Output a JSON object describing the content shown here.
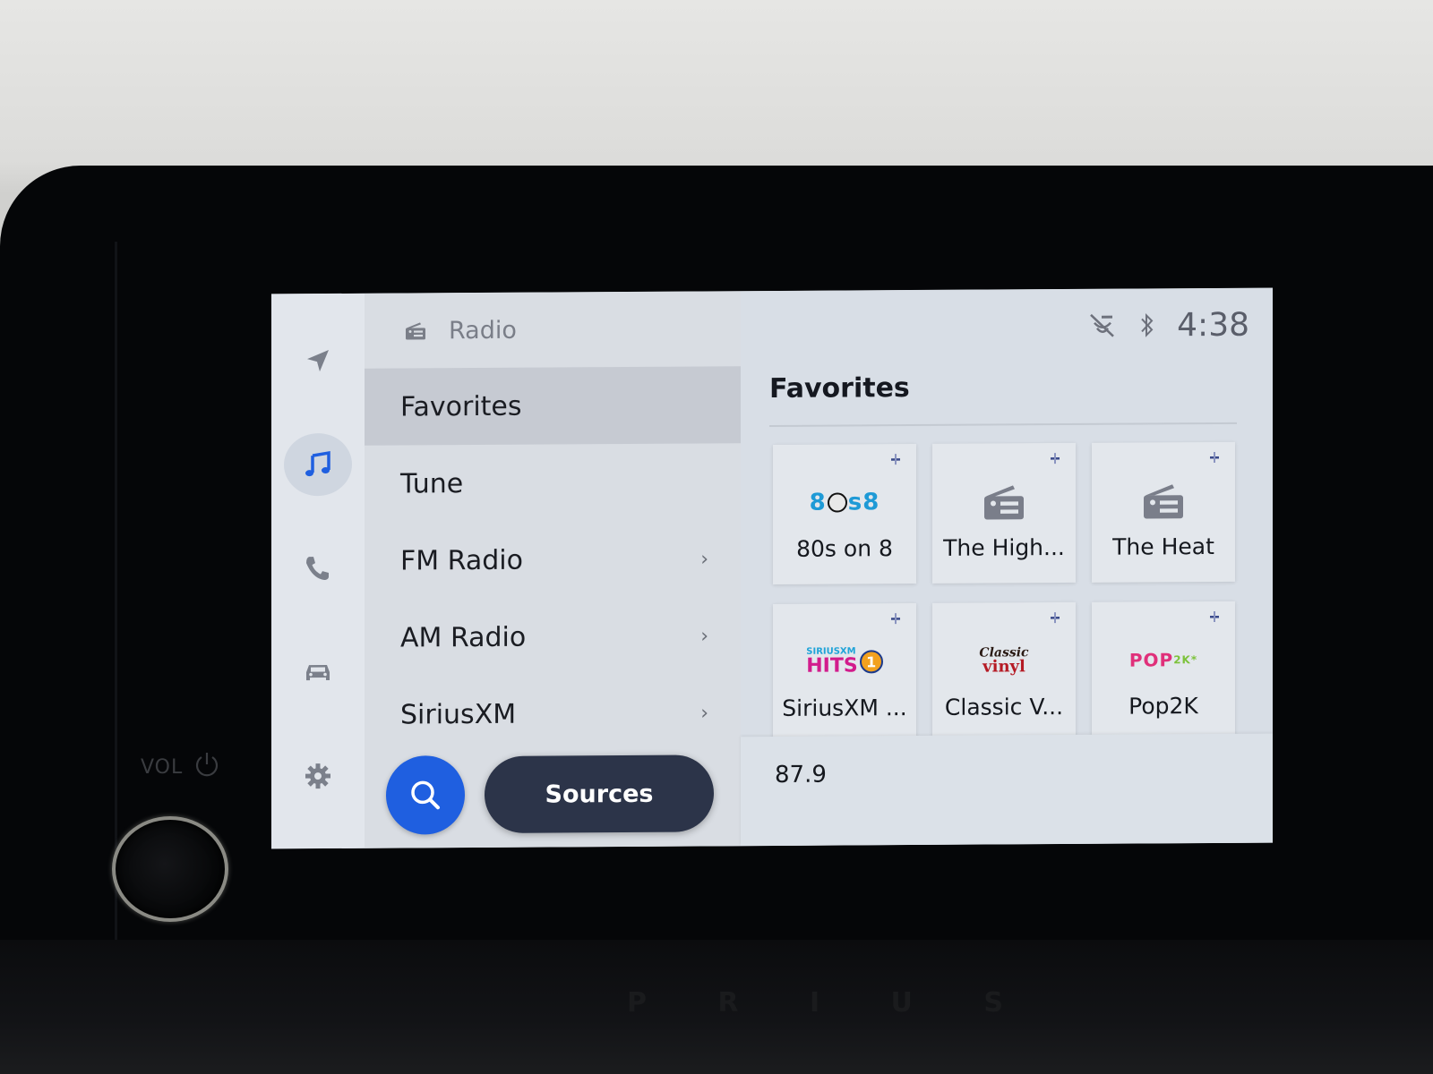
{
  "hardware": {
    "vol_label": "VOL",
    "brand_letters": [
      "P",
      "R",
      "I",
      "U",
      "S"
    ]
  },
  "rail": {
    "items": [
      {
        "name": "navigation",
        "icon": "navigation-arrow-icon",
        "active": false
      },
      {
        "name": "music",
        "icon": "music-note-icon",
        "active": true
      },
      {
        "name": "phone",
        "icon": "phone-icon",
        "active": false
      },
      {
        "name": "vehicle",
        "icon": "car-icon",
        "active": false
      },
      {
        "name": "settings",
        "icon": "gear-icon",
        "active": false
      }
    ],
    "accent_color": "#1f5fe0"
  },
  "menu": {
    "header": {
      "icon": "radio-icon",
      "title": "Radio"
    },
    "items": [
      {
        "label": "Favorites",
        "selected": true,
        "has_chevron": false
      },
      {
        "label": "Tune",
        "selected": false,
        "has_chevron": false
      },
      {
        "label": "FM Radio",
        "selected": false,
        "has_chevron": true
      },
      {
        "label": "AM Radio",
        "selected": false,
        "has_chevron": true
      },
      {
        "label": "SiriusXM",
        "selected": false,
        "has_chevron": true
      }
    ],
    "chevron_glyph": "›",
    "search_button": {
      "icon": "search-icon"
    },
    "sources_button": {
      "label": "Sources"
    }
  },
  "status_bar": {
    "icons": [
      "mic-off-icon",
      "bluetooth-icon"
    ],
    "clock": "4:38"
  },
  "content": {
    "title": "Favorites",
    "favorites": [
      {
        "name": "80s on 8",
        "logo": "80s-on-8-logo",
        "logo_text": "8",
        "logo_text2": "s8"
      },
      {
        "name": "The High...",
        "logo": "radio-icon"
      },
      {
        "name": "The Heat",
        "logo": "radio-icon"
      },
      {
        "name": "SiriusXM ...",
        "logo": "siriusxm-hits1-logo",
        "logo_top": "SIRIUSXM",
        "logo_main": "HITS",
        "logo_num": "1"
      },
      {
        "name": "Classic V...",
        "logo": "classic-vinyl-logo",
        "logo_top": "Classic",
        "logo_main": "vinyl"
      },
      {
        "name": "Pop2K",
        "logo": "pop2k-logo",
        "logo_main": "POP",
        "logo_suffix": "2K*"
      }
    ],
    "now_playing": {
      "frequency": "87.9"
    }
  }
}
